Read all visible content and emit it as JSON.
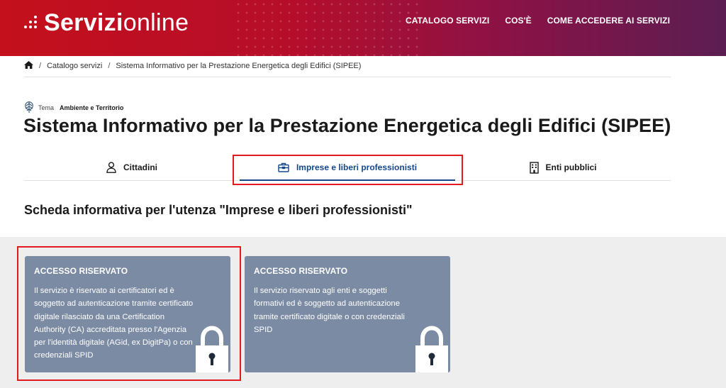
{
  "header": {
    "logo_bold": "Servizi",
    "logo_light": "online",
    "nav": [
      "CATALOGO SERVIZI",
      "COS'È",
      "COME ACCEDERE AI SERVIZI"
    ]
  },
  "breadcrumb": {
    "home_icon": "home-icon",
    "items": [
      "Catalogo servizi",
      "Sistema Informativo per la Prestazione Energetica degli Edifici (SIPEE)"
    ]
  },
  "tema": {
    "label": "Tema",
    "value": "Ambiente e Territorio",
    "icon": "tree-icon"
  },
  "page_title": "Sistema Informativo per la Prestazione Energetica degli Edifici (SIPEE)",
  "tabs": [
    {
      "label": "Cittadini",
      "icon": "user-icon",
      "active": false
    },
    {
      "label": "Imprese e liberi professionisti",
      "icon": "briefcase-icon",
      "active": true
    },
    {
      "label": "Enti pubblici",
      "icon": "building-icon",
      "active": false
    }
  ],
  "section_title": "Scheda informativa per l'utenza \"Imprese e liberi professionisti\"",
  "cards": [
    {
      "title": "ACCESSO RISERVATO",
      "text": "Il servizio è riservato ai certificatori ed è soggetto ad autenticazione tramite certificato digitale rilasciato da una Certification Authority (CA) accreditata presso l'Agenzia per l'identità digitale (AGid, ex DigitPa) o con credenziali SPID",
      "icon": "lock-icon"
    },
    {
      "title": "ACCESSO RISERVATO",
      "text": "Il servizio riservato agli enti e soggetti formativi ed è soggetto ad autenticazione tramite certificato digitale o con credenziali SPID",
      "icon": "lock-icon"
    }
  ],
  "colors": {
    "header_red": "#c4101c",
    "header_purple": "#5b1e52",
    "active_tab": "#14488a",
    "card_bg": "#7b8ba4",
    "highlight": "#e2191e"
  }
}
